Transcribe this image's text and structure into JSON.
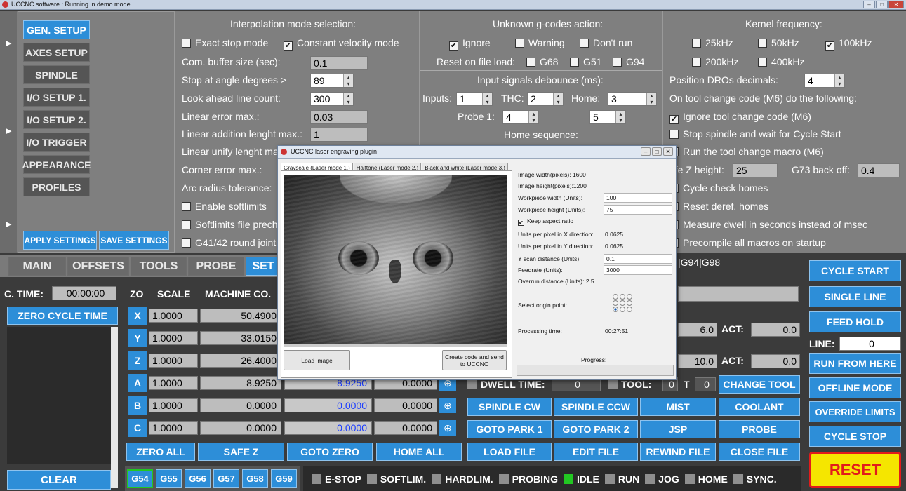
{
  "window": {
    "title": "UCCNC software : Running in demo mode..."
  },
  "settings_nav": [
    "GEN. SETUP",
    "AXES SETUP",
    "SPINDLE",
    "I/O SETUP 1.",
    "I/O SETUP 2.",
    "I/O TRIGGER",
    "APPEARANCE",
    "PROFILES"
  ],
  "apply_settings": "APPLY SETTINGS",
  "save_settings": "SAVE SETTINGS",
  "interp": {
    "title": "Interpolation mode selection:",
    "exact_stop": "Exact stop mode",
    "const_vel": "Constant velocity mode",
    "rows": [
      {
        "label": "Com. buffer size (sec):",
        "value": "0.1"
      },
      {
        "label": "Stop at angle degrees >",
        "value": "89"
      },
      {
        "label": "Look ahead line count:",
        "value": "300"
      },
      {
        "label": "Linear error max.:",
        "value": "0.03"
      },
      {
        "label": "Linear addition lenght max.:",
        "value": "1"
      },
      {
        "label": "Linear unify lenght ma",
        "value": ""
      },
      {
        "label": "Corner error max.:",
        "value": ""
      },
      {
        "label": "Arc radius tolerance:",
        "value": ""
      }
    ],
    "enable_softlimits": "Enable softlimits",
    "softlimits_file": "Softlimits file prech",
    "g41": "G41/42 round joints"
  },
  "gcodes": {
    "title": "Unknown g-codes action:",
    "ignore": "Ignore",
    "warning": "Warning",
    "dont_run": "Don't run",
    "reset_label": "Reset on file load:",
    "g68": "G68",
    "g51": "G51",
    "g94": "G94",
    "debounce_title": "Input signals debounce (ms):",
    "inputs": "Inputs:",
    "inputs_val": "1",
    "thc": "THC:",
    "thc_val": "2",
    "home": "Home:",
    "home_val": "3",
    "probe1": "Probe 1:",
    "probe1_val": "4",
    "probe2_val": "5",
    "home_seq": "Home sequence:"
  },
  "kernel": {
    "title": "Kernel frequency:",
    "f25": "25kHz",
    "f50": "50kHz",
    "f100": "100kHz",
    "f200": "200kHz",
    "f400": "400kHz",
    "dro_label": "Position DROs decimals:",
    "dro_val": "4",
    "m6_label": "On tool change code (M6) do the following:",
    "m6_ignore": "Ignore tool change code (M6)",
    "m6_stop": "Stop spindle and wait for Cycle Start",
    "m6_macro": "Run the tool change macro (M6)",
    "safe_z": "afe Z height:",
    "safe_z_val": "25",
    "g73": "G73 back off:",
    "g73_val": "0.4",
    "cycle_check": "Cycle check homes",
    "reset_deref": "Reset deref. homes",
    "dwell": "Measure dwell in seconds instead of msec",
    "precompile": "Precompile all macros on startup"
  },
  "tabs": [
    "MAIN",
    "OFFSETS",
    "TOOLS",
    "PROBE",
    "SET"
  ],
  "ctime_label": "C. TIME:",
  "ctime_val": "00:00:00",
  "zero_cycle": "ZERO CYCLE TIME",
  "clear": "CLEAR",
  "dro_headers": {
    "zo": "ZO",
    "scale": "SCALE",
    "machine": "MACHINE CO."
  },
  "axes": [
    {
      "name": "X",
      "scale": "1.0000",
      "machine": "50.4900",
      "work": "",
      "offset": ""
    },
    {
      "name": "Y",
      "scale": "1.0000",
      "machine": "33.0150",
      "work": "",
      "offset": ""
    },
    {
      "name": "Z",
      "scale": "1.0000",
      "machine": "26.4000",
      "work": "",
      "offset": ""
    },
    {
      "name": "A",
      "scale": "1.0000",
      "machine": "8.9250",
      "work": "8.9250",
      "offset": "0.0000"
    },
    {
      "name": "B",
      "scale": "1.0000",
      "machine": "0.0000",
      "work": "0.0000",
      "offset": "0.0000"
    },
    {
      "name": "C",
      "scale": "1.0000",
      "machine": "0.0000",
      "work": "0.0000",
      "offset": "0.0000"
    }
  ],
  "gcode_line": "|G94|G98",
  "feed": {
    "val1": "6.0",
    "act": "ACT:",
    "act1": "0.0",
    "val2": "10.0",
    "act2": "0.0",
    "dwell": "DWELL TIME:",
    "dwell_val": "0",
    "tool": "TOOL:",
    "tool_val": "0",
    "t": "T",
    "t_val": "0",
    "change_tool": "CHANGE TOOL"
  },
  "bottom_buttons": [
    "ZERO ALL",
    "SAFE Z",
    "GOTO ZERO",
    "HOME ALL"
  ],
  "mid_buttons": [
    [
      "SPINDLE CW",
      "SPINDLE CCW",
      "MIST",
      "COOLANT"
    ],
    [
      "GOTO PARK 1",
      "GOTO PARK 2",
      "JSP",
      "PROBE"
    ],
    [
      "LOAD FILE",
      "EDIT FILE",
      "REWIND FILE",
      "CLOSE FILE"
    ]
  ],
  "right_buttons": {
    "cycle_start": "CYCLE START",
    "single_line": "SINGLE LINE",
    "feed_hold": "FEED HOLD",
    "line": "LINE:",
    "line_val": "0",
    "run_from_here": "RUN FROM HERE",
    "offline": "OFFLINE MODE",
    "override": "OVERRIDE LIMITS",
    "cycle_stop": "CYCLE STOP",
    "reset": "RESET"
  },
  "work_offsets": [
    "G54",
    "G55",
    "G56",
    "G57",
    "G58",
    "G59"
  ],
  "status": [
    "E-STOP",
    "SOFTLIM.",
    "HARDLIM.",
    "PROBING",
    "IDLE",
    "RUN",
    "JOG",
    "HOME",
    "SYNC."
  ],
  "dialog": {
    "title": "UCCNC laser engraving plugin",
    "tabs": [
      "Grayscale (Laser mode 1.)",
      "Halftone (Laser mode 2.)",
      "Black and white (Laser mode 3.)"
    ],
    "img_w": "Image width(pixels): 1600",
    "img_h": "Image height(pixels):1200",
    "wp_w": "Workpiece width (Units):",
    "wp_w_val": "100",
    "wp_h": "Workpiece height (Units):",
    "wp_h_val": "75",
    "keep": "Keep aspect ratio",
    "upx": "Units per pixel in X direction:",
    "upx_val": "0.0625",
    "upy": "Units per pixel in Y direction:",
    "upy_val": "0.0625",
    "yscan": "Y scan distance (Units):",
    "yscan_val": "0.1",
    "feed": "Feedrate (Units):",
    "feed_val": "3000",
    "overrun": "Overrun distance (Units): 2.5",
    "origin": "Select origin point:",
    "proc": "Processing time:",
    "proc_val": "00:27:51",
    "load": "Load image",
    "create": "Create code and send to UCCNC",
    "progress": "Progress:"
  },
  "colors": {
    "accent": "#2d8ed8",
    "reset_bg": "#f5e600",
    "reset_fg": "#e21b1b",
    "idle": "#22c722"
  }
}
